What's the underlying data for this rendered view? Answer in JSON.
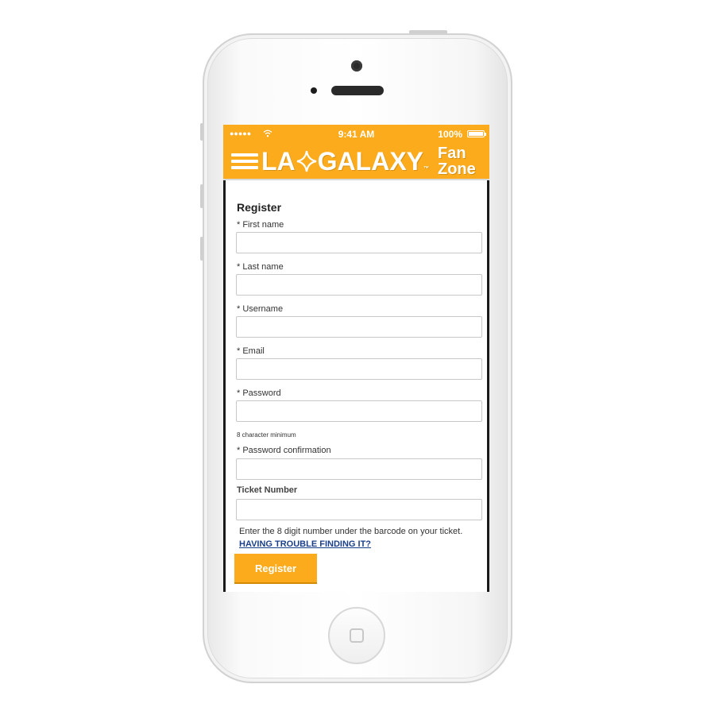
{
  "status_bar": {
    "signal": "●●●●●",
    "time": "9:41 AM",
    "battery": "100%"
  },
  "header": {
    "logo_la": "LA",
    "logo_galaxy": "GALAXY",
    "logo_tm": "™",
    "fan": "Fan",
    "zone": "Zone"
  },
  "form": {
    "title": "Register",
    "first_name_label": "* First name",
    "first_name_value": "",
    "last_name_label": "* Last name",
    "last_name_value": "",
    "username_label": "* Username",
    "username_value": "",
    "email_label": "* Email",
    "email_value": "",
    "password_label": "* Password",
    "password_value": "",
    "password_hint": "8 character minimum",
    "password_confirm_label": "* Password confirmation",
    "password_confirm_value": "",
    "ticket_label": "Ticket Number",
    "ticket_value": "",
    "ticket_help": "Enter the 8 digit number under the barcode on your ticket.",
    "ticket_help_link": "HAVING TROUBLE FINDING IT?",
    "submit_label": "Register"
  },
  "colors": {
    "brand": "#fbab1b",
    "link": "#1a3f88"
  }
}
